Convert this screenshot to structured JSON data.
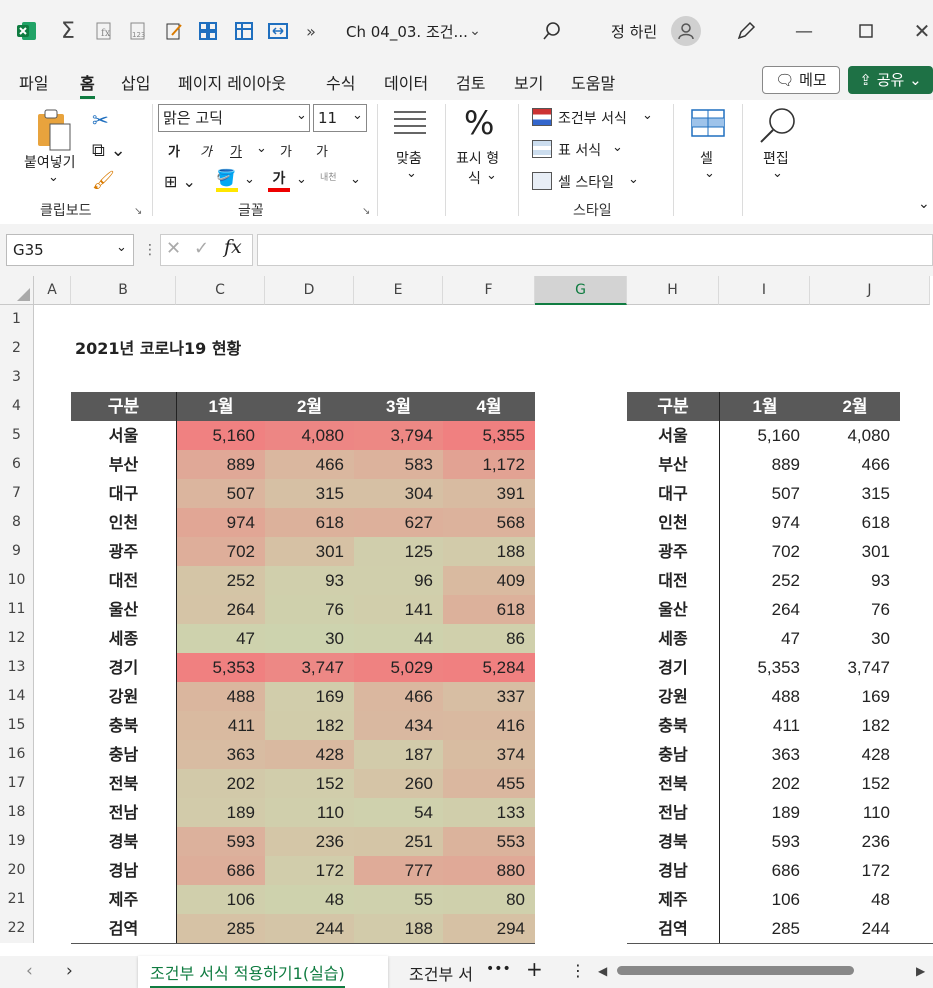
{
  "titlebar": {
    "doc_title": "Ch 04_03. 조건...",
    "user": "정 하린"
  },
  "menu": [
    "파일",
    "홈",
    "삽입",
    "페이지 레이아웃",
    "수식",
    "데이터",
    "검토",
    "보기",
    "도움말"
  ],
  "memo_label": "메모",
  "share_label": "공유",
  "ribbon": {
    "paste_label": "붙여넣기",
    "clipboard_group": "클립보드",
    "font_name": "맑은 고딕",
    "font_size": "11",
    "font_group": "글꼴",
    "align_label": "맞춤",
    "number_label_1": "표시 형",
    "number_label_2": "식",
    "cond_format": "조건부 서식",
    "table_format": "표 서식",
    "cell_style": "셀 스타일",
    "style_group": "스타일",
    "cells_label": "셀",
    "edit_label": "편집",
    "bold": "가",
    "italic": "가",
    "underline": "가",
    "grow": "가",
    "shrink": "가",
    "phonetic": "내천"
  },
  "namebox": "G35",
  "formula": "",
  "columns": [
    "A",
    "B",
    "C",
    "D",
    "E",
    "F",
    "G",
    "H",
    "I",
    "J"
  ],
  "rows": [
    "1",
    "2",
    "3",
    "4",
    "5",
    "6",
    "7",
    "8",
    "9",
    "10",
    "11",
    "12",
    "13",
    "14",
    "15",
    "16",
    "17",
    "18",
    "19",
    "20",
    "21",
    "22"
  ],
  "sheet_title": "2021년 코로나19 현황",
  "table_headers": [
    "구분",
    "1월",
    "2월",
    "3월",
    "4월"
  ],
  "table_rows": [
    {
      "region": "서울",
      "v": [
        "5,160",
        "4,080",
        "3,794",
        "5,355"
      ]
    },
    {
      "region": "부산",
      "v": [
        "889",
        "466",
        "583",
        "1,172"
      ]
    },
    {
      "region": "대구",
      "v": [
        "507",
        "315",
        "304",
        "391"
      ]
    },
    {
      "region": "인천",
      "v": [
        "974",
        "618",
        "627",
        "568"
      ]
    },
    {
      "region": "광주",
      "v": [
        "702",
        "301",
        "125",
        "188"
      ]
    },
    {
      "region": "대전",
      "v": [
        "252",
        "93",
        "96",
        "409"
      ]
    },
    {
      "region": "울산",
      "v": [
        "264",
        "76",
        "141",
        "618"
      ]
    },
    {
      "region": "세종",
      "v": [
        "47",
        "30",
        "44",
        "86"
      ]
    },
    {
      "region": "경기",
      "v": [
        "5,353",
        "3,747",
        "5,029",
        "5,284"
      ]
    },
    {
      "region": "강원",
      "v": [
        "488",
        "169",
        "466",
        "337"
      ]
    },
    {
      "region": "충북",
      "v": [
        "411",
        "182",
        "434",
        "416"
      ]
    },
    {
      "region": "충남",
      "v": [
        "363",
        "428",
        "187",
        "374"
      ]
    },
    {
      "region": "전북",
      "v": [
        "202",
        "152",
        "260",
        "455"
      ]
    },
    {
      "region": "전남",
      "v": [
        "189",
        "110",
        "54",
        "133"
      ]
    },
    {
      "region": "경북",
      "v": [
        "593",
        "236",
        "251",
        "553"
      ]
    },
    {
      "region": "경남",
      "v": [
        "686",
        "172",
        "777",
        "880"
      ]
    },
    {
      "region": "제주",
      "v": [
        "106",
        "48",
        "55",
        "80"
      ]
    },
    {
      "region": "검역",
      "v": [
        "285",
        "244",
        "188",
        "294"
      ]
    }
  ],
  "table2_headers": [
    "구분",
    "1월",
    "2월"
  ],
  "colors": {
    "header_bg": "#595959",
    "excel_green": "#107c41",
    "share_bg": "#1e7145"
  },
  "sheet_tabs": {
    "active": "조건부 서식 적용하기1(실습)",
    "next": "조건부 서"
  }
}
